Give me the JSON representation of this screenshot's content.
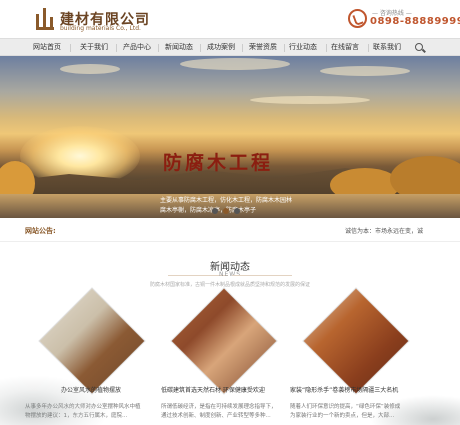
{
  "header": {
    "brand_cn": "建材有限公司",
    "brand_en": "building materials Co., Ltd.",
    "hotline_label": "— 咨询热线 —",
    "hotline_number": "0898-88889999",
    "accent": "#8a5a2b"
  },
  "nav": {
    "items": [
      "网站首页",
      "关于我们",
      "产品中心",
      "新闻动态",
      "成功案例",
      "荣誉资质",
      "行业动态",
      "在线留言",
      "联系我们"
    ],
    "search_icon": "search-icon"
  },
  "banner": {
    "title": "防腐木工程",
    "lines": [
      "主要从事防腐木工程，仿化木工程，防腐木木园林",
      "腐木亭榭，防腐木凉亭，防腐木亭子"
    ],
    "slides": 3,
    "active_slide": 1
  },
  "notice": {
    "label": "网站公告:",
    "text": "诚信为本：市场永远在变，诚"
  },
  "news": {
    "title": "新闻动态",
    "subtitle": "NEWS",
    "desc": "防腐木材国家标准，古铜一件木制品根成就品质坚持和规范的发展的保证"
  },
  "cards": [
    {
      "title": "办公室风水的植物摆放",
      "desc": [
        "从事多年办公风水的大师对办公室摆种风水中植",
        "物摆放的建议：1，东方五行属木，庭院..."
      ]
    },
    {
      "title": "低碳建筑首选天然石材 环保健康受欢迎",
      "desc": [
        "所谓低碳经济，是指在可持续发展理念指导下，",
        "通过技术创新、制度创新、产业转型等多种..."
      ]
    },
    {
      "title": "家装“隐形杀手”卷袭榜市场隔疆三大名机",
      "desc": [
        "随着人们环保意识的提高，“绿色环保”装修成",
        "为家装行业的一个新的卖点，但是，大部..."
      ]
    }
  ]
}
